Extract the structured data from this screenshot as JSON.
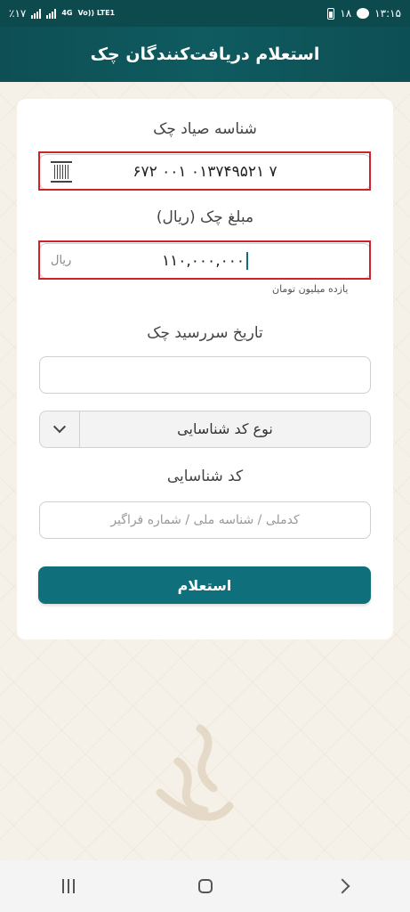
{
  "status_bar": {
    "battery_percent": "٪۱۷",
    "network": "4G",
    "volte": "Vo)) LTE1",
    "notification_count": "۱۸",
    "time": "۱۳:۱۵"
  },
  "header": {
    "title": "استعلام دریافت‌کنندگان چک"
  },
  "form": {
    "sayad_label": "شناسه صیاد چک",
    "sayad_value": "۶۷۲ ۰۰۱ ۰۱۳۷۴۹۵۲۱ ۷",
    "amount_label": "مبلغ چک (ریال)",
    "amount_value": "۱۱۰,۰۰۰,۰۰۰",
    "amount_unit": "ریال",
    "amount_words": "یازده میلیون تومان",
    "due_date_label": "تاریخ سررسید چک",
    "due_date_value": "",
    "id_type_selected": "نوع کد شناسایی",
    "id_code_label": "کد شناسایی",
    "id_code_placeholder": "کدملی / شناسه ملی / شماره فراگیر",
    "submit_label": "استعلام"
  },
  "colors": {
    "header_bg": "#0d4f54",
    "button_bg": "#0f6f7a",
    "highlight": "#d0222d"
  }
}
